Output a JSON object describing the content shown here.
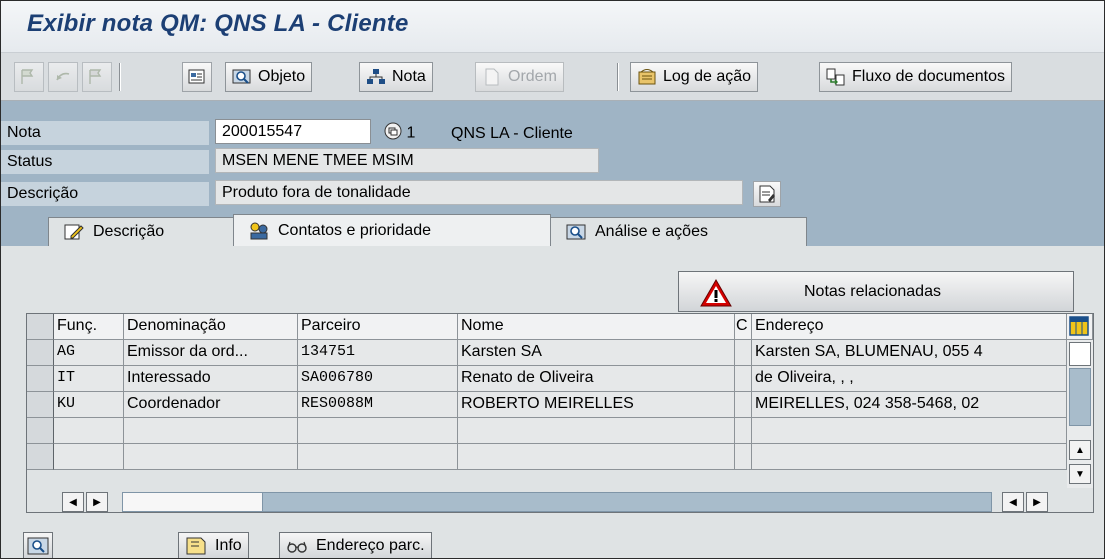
{
  "window": {
    "title": "Exibir nota QM: QNS LA - Cliente"
  },
  "toolbar": {
    "objeto_label": "Objeto",
    "nota_label": "Nota",
    "ordem_label": "Ordem",
    "log_label": "Log de ação",
    "fluxo_label": "Fluxo de documentos"
  },
  "header": {
    "nota_label": "Nota",
    "nota_value": "200015547",
    "nota_suffix": "1",
    "nota_desc": "QNS LA - Cliente",
    "status_label": "Status",
    "status_value": "MSEN MENE TMEE MSIM",
    "descricao_label": "Descrição",
    "descricao_value": "Produto fora de tonalidade"
  },
  "tabs": [
    {
      "label": "Descrição",
      "icon": "pencil-icon"
    },
    {
      "label": "Contatos e prioridade",
      "icon": "partners-icon"
    },
    {
      "label": "Análise e ações",
      "icon": "magnifier-icon"
    }
  ],
  "notas_relacionadas": {
    "label": "Notas relacionadas",
    "icon": "warning-icon"
  },
  "table": {
    "columns": [
      "Funç.",
      "Denominação",
      "Parceiro",
      "Nome",
      "C",
      "Endereço"
    ],
    "rows": [
      [
        "AG",
        "Emissor da ord...",
        "134751",
        "Karsten SA",
        "",
        "Karsten SA, BLUMENAU, 055 4"
      ],
      [
        "IT",
        "Interessado",
        "SA006780",
        "Renato de Oliveira",
        "",
        "de Oliveira, , ,"
      ],
      [
        "KU",
        "Coordenador",
        "RES0088M",
        "ROBERTO MEIRELLES",
        "",
        "MEIRELLES, 024 358-5468, 02"
      ],
      [
        "",
        "",
        "",
        "",
        "",
        ""
      ],
      [
        "",
        "",
        "",
        "",
        "",
        ""
      ]
    ]
  },
  "bottom": {
    "info_label": "Info",
    "endereco_label": "Endereço parc."
  },
  "colors": {
    "title": "#1c3f74",
    "header_bg": "#9fb4c5",
    "label_bg": "#c6d3dd",
    "warning": "#d40000"
  }
}
